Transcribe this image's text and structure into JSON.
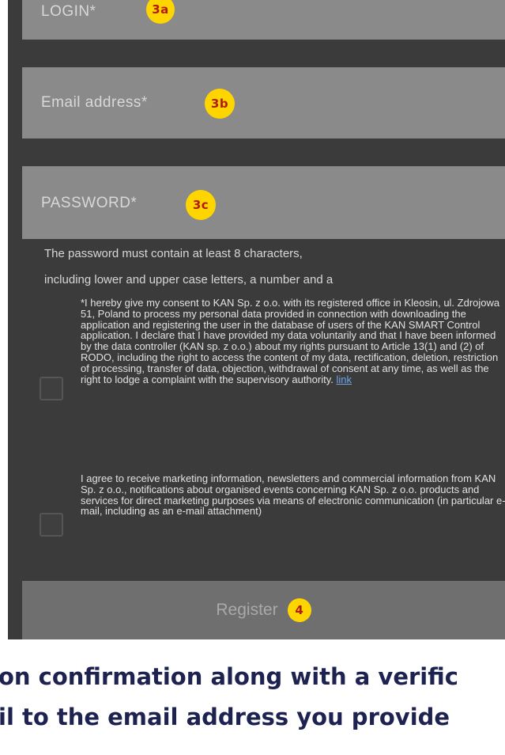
{
  "form": {
    "login_placeholder": "LOGIN*",
    "login_badge": "3a",
    "email_placeholder": "Email address*",
    "email_badge": "3b",
    "password_placeholder": "PASSWORD*",
    "password_badge": "3c",
    "password_hint_line1": "The password must contain at least 8 characters,",
    "password_hint_line2": "including lower and upper case letters, a number and a",
    "consent_gdpr": "*I hereby give my consent to KAN Sp. z o.o. with its registered office in Kleosin, ul. Zdrojowa 51, Poland to process my personal data provided in connection with downloading the application and registering the user in the database of users of the KAN SMART Control application. I declare that I have provided my data voluntarily and that I have been informed by the data controller (KAN sp. z o.o.) about my rights pursuant to Article 13(1) and (2) of RODO, including the right to access the content of my data, rectification, deletion, restriction of processing, transfer of data, objection, withdrawal of consent at any time, as well as the right to lodge a complaint with the supervisory authority.",
    "consent_gdpr_link": "link",
    "consent_marketing": "I agree to receive marketing information, newsletters and commercial information from KAN Sp. z o.o., notifications about organised events concerning KAN Sp. z o.o. products and services for direct marketing purposes via means of electronic communication (in particular e-mail, including as an e-mail attachment)",
    "register_label": "Register",
    "register_badge": "4"
  },
  "caption": {
    "line1": "on confirmation along with a verific",
    "line2": "il to the email address you provide"
  },
  "colors": {
    "screen_bg": "#3b3b3b",
    "field_bg": "#8a8a8a",
    "button_bg": "#6f6f6f",
    "badge_bg": "#ffd500",
    "badge_text": "#b41b0f",
    "caption_text": "#1e2250",
    "link": "#6fa6e8"
  }
}
